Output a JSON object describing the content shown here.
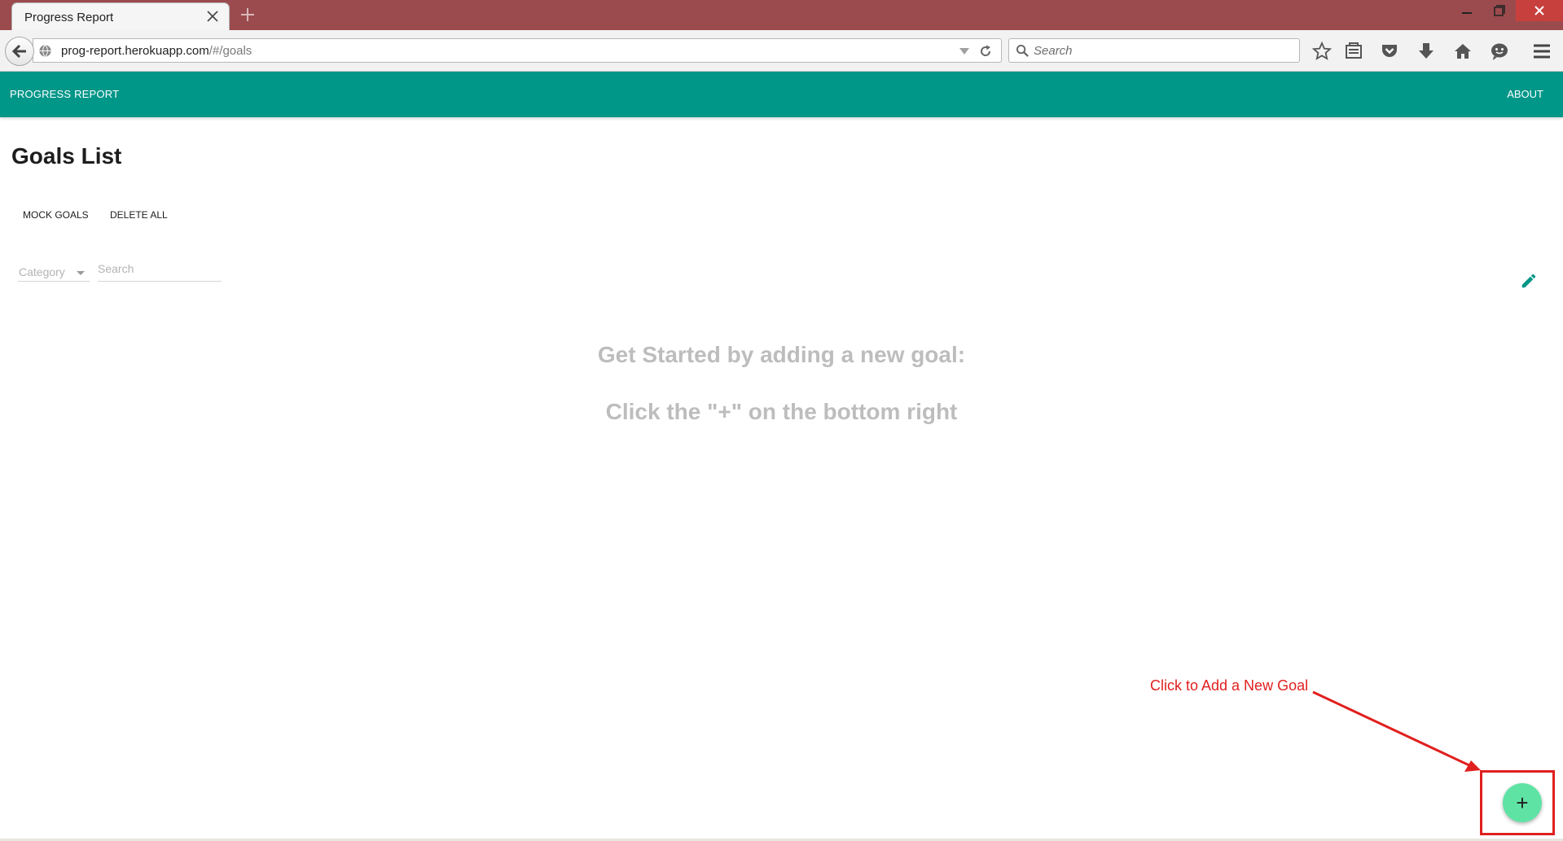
{
  "browser": {
    "tab_title": "Progress Report",
    "url_host": "prog-report.herokuapp.com",
    "url_path": "/#/goals",
    "search_placeholder": "Search"
  },
  "app": {
    "brand": "PROGRESS REPORT",
    "about": "ABOUT",
    "accent_color": "#009688",
    "fab_color": "#5fe3a4"
  },
  "goals": {
    "title": "Goals List",
    "mock_goals_label": "MOCK GOALS",
    "delete_all_label": "DELETE ALL",
    "category_placeholder": "Category",
    "search_placeholder": "Search",
    "empty_line1": "Get Started by adding a new goal:",
    "empty_line2": "Click the \"+\" on the bottom right",
    "fab_label": "+"
  },
  "annotation": {
    "text": "Click to Add a New Goal",
    "color": "#e0201e"
  },
  "icons": [
    "back-arrow-icon",
    "globe-icon",
    "dropdown-icon",
    "reload-icon",
    "search-icon",
    "star-icon",
    "reading-list-icon",
    "pocket-icon",
    "download-icon",
    "home-icon",
    "chat-icon",
    "menu-icon",
    "close-icon",
    "plus-icon",
    "minimize-icon",
    "restore-icon",
    "pencil-icon"
  ]
}
